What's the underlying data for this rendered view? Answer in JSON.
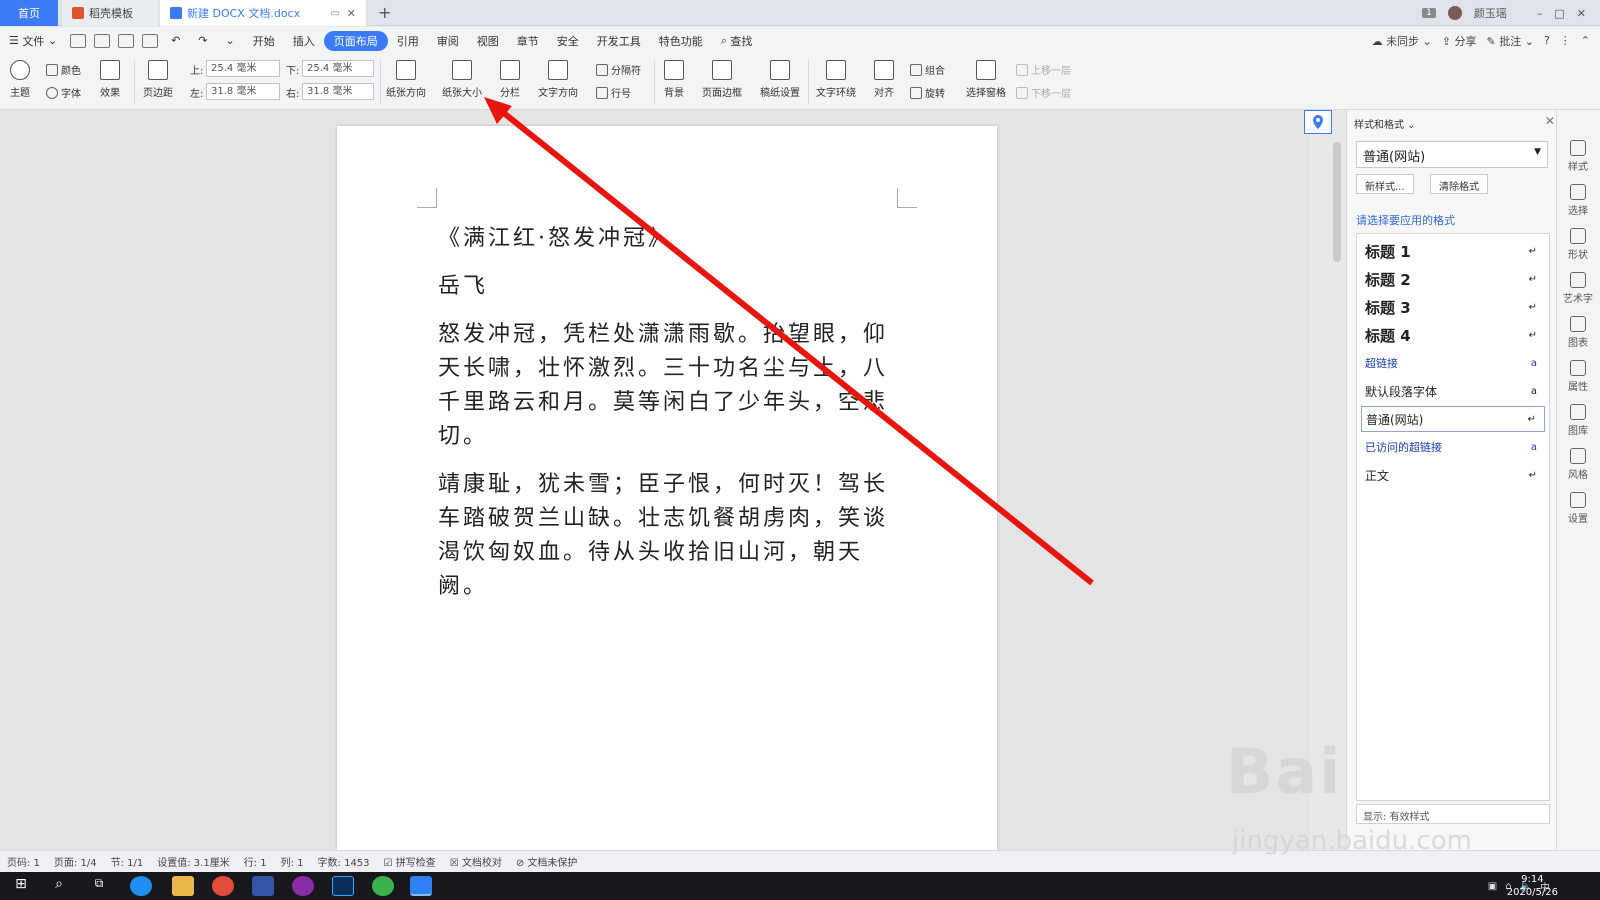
{
  "tabs": {
    "home": "首页",
    "template": "稻壳模板",
    "document": "新建 DOCX 文档.docx",
    "new_tab": "+"
  },
  "titlebar": {
    "badge": "1",
    "user": "颜玉瑶",
    "min": "–",
    "max": "□",
    "close": "✕"
  },
  "menu": {
    "file": "文件",
    "items": [
      "开始",
      "插入",
      "页面布局",
      "引用",
      "审阅",
      "视图",
      "章节",
      "安全",
      "开发工具",
      "特色功能"
    ],
    "active": "页面布局",
    "search": "查找",
    "right": {
      "sync": "未同步",
      "share": "分享",
      "review": "批注",
      "help": "?"
    }
  },
  "ribbon": {
    "theme": "主题",
    "color": "颜色",
    "font": "字体",
    "effect": "效果",
    "margins": "页边距",
    "top_label": "上:",
    "top_value": "25.4 毫米",
    "bottom_label": "下:",
    "bottom_value": "25.4 毫米",
    "left_label": "左:",
    "left_value": "31.8 毫米",
    "right_label": "右:",
    "right_value": "31.8 毫米",
    "orientation": "纸张方向",
    "size": "纸张大小",
    "columns": "分栏",
    "text_direction": "文字方向",
    "separator": "分隔符",
    "line_number": "行号",
    "background": "背景",
    "page_border": "页面边框",
    "draft_settings": "稿纸设置",
    "wrap": "文字环绕",
    "align": "对齐",
    "group": "组合",
    "rotate": "旋转",
    "selection_pane": "选择窗格",
    "bring_forward": "上移一层",
    "send_backward": "下移一层"
  },
  "document": {
    "title": "《满江红·怒发冲冠》",
    "author": "岳飞",
    "para1": "怒发冲冠，凭栏处潇潇雨歇。抬望眼，仰天长啸，壮怀激烈。三十功名尘与土，八千里路云和月。莫等闲白了少年头，空悲切。",
    "para2": "靖康耻，犹未雪；臣子恨，何时灭！驾长车踏破贺兰山缺。壮志饥餐胡虏肉，笑谈渴饮匈奴血。待从头收拾旧山河，朝天阙。"
  },
  "pane": {
    "title": "样式和格式",
    "current": "普通(网站)",
    "new_style": "新样式...",
    "clear": "清除格式",
    "hint": "请选择要应用的格式",
    "styles": [
      "标题 1",
      "标题 2",
      "标题 3",
      "标题 4",
      "超链接",
      "默认段落字体",
      "普通(网站)",
      "已访问的超链接",
      "正文"
    ],
    "bottom_label": "显示: 有效样式"
  },
  "right_strip": [
    "样式",
    "选择",
    "形状",
    "艺术字",
    "图表",
    "属性",
    "图库",
    "风格",
    "设置"
  ],
  "status": {
    "page": "页码: 1",
    "pages": "页面: 1/4",
    "section": "节: 1/1",
    "setting": "设置值: 3.1厘米",
    "row": "行: 1",
    "col": "列: 1",
    "words": "字数: 1453",
    "spell": "拼写检查",
    "proof": "文档校对",
    "protect": "文档未保护"
  },
  "taskbar": {
    "time": "9:14",
    "date": "2020/5/26",
    "ime": "中"
  },
  "watermark": {
    "brand": "Bai",
    "sub": "jingyan.baidu.com"
  }
}
